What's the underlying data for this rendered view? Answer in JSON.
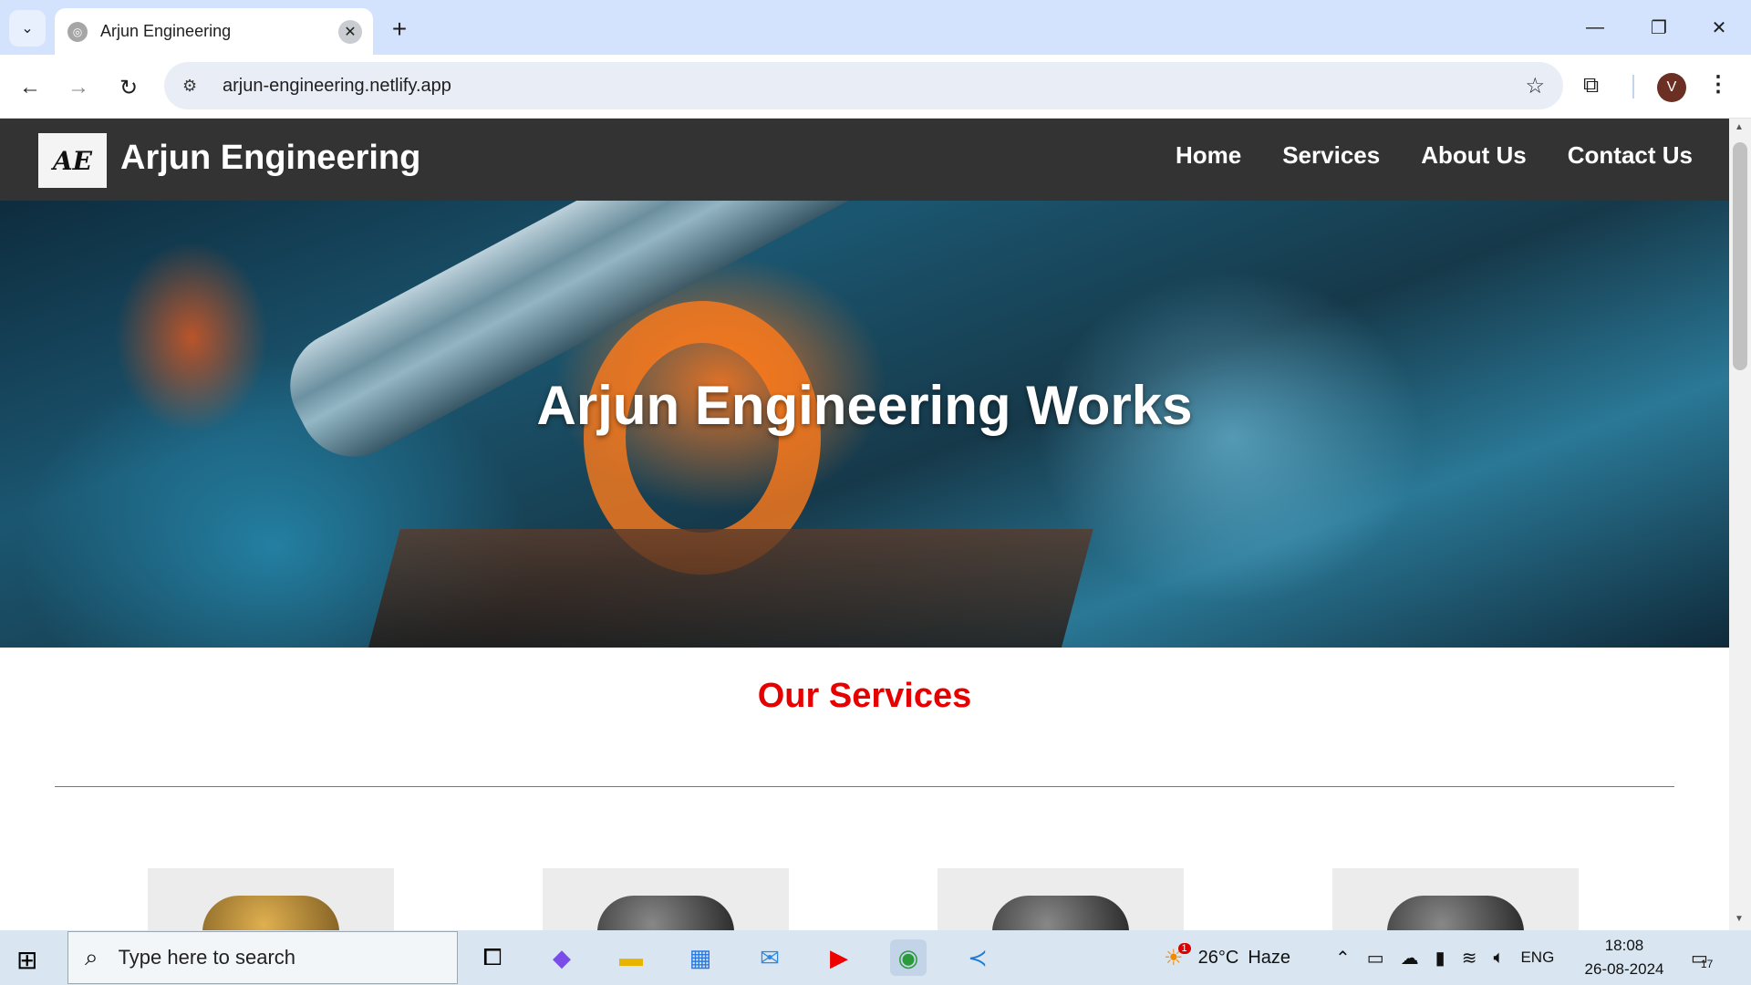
{
  "browser": {
    "tab_title": "Arjun Engineering",
    "url": "arjun-engineering.netlify.app",
    "profile_initial": "V"
  },
  "site": {
    "logo_text": "AE",
    "brand": "Arjun Engineering",
    "menu": [
      "Home",
      "Services",
      "About Us",
      "Contact Us"
    ],
    "hero_title": "Arjun Engineering Works",
    "section_title": "Our Services"
  },
  "taskbar": {
    "search_placeholder": "Type here to search",
    "weather_temp": "26°C",
    "weather_desc": "Haze",
    "weather_badge": "1",
    "language": "ENG",
    "time": "18:08",
    "date": "26-08-2024",
    "notification_count": "17"
  },
  "colors": {
    "nav_bg": "#333333",
    "section_title": "#e60000",
    "tabstrip": "#d3e3fd"
  }
}
